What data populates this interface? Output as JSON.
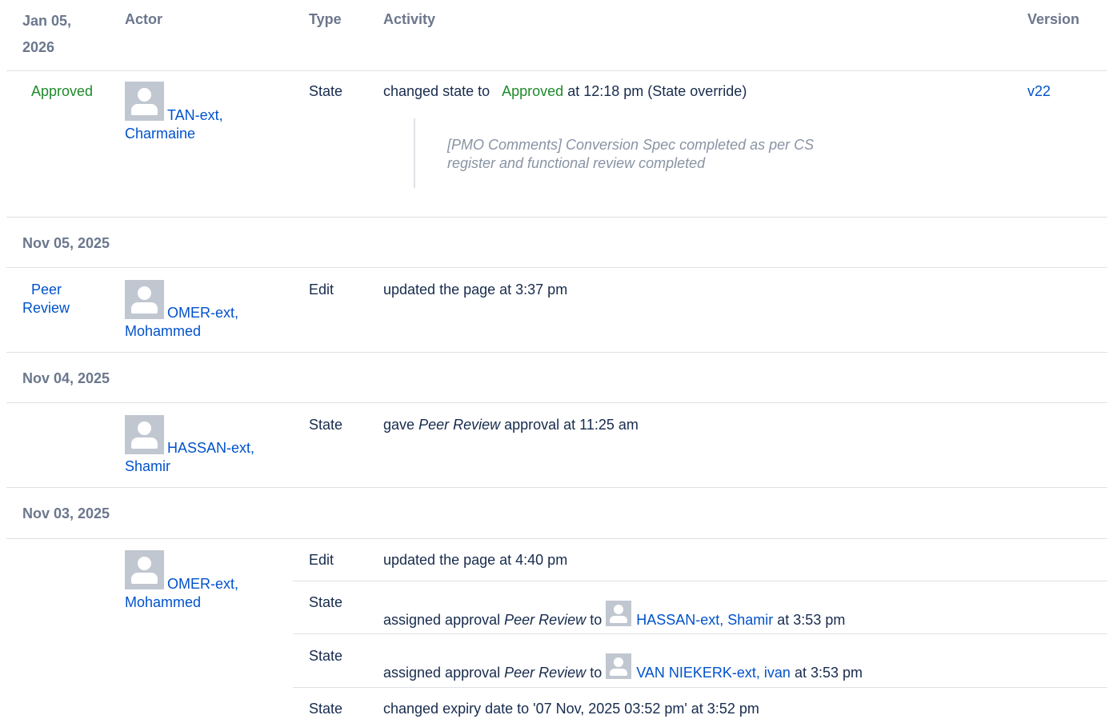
{
  "headers": {
    "date": "Jan 05, 2026",
    "actor": "Actor",
    "type": "Type",
    "activity": "Activity",
    "version": "Version"
  },
  "groups": [
    {
      "date": "Jan 05, 2026",
      "state_label": "Approved",
      "actor_name": "TAN-ext, Charmaine",
      "entries": [
        {
          "type": "State",
          "text_pre": "changed state to",
          "state": "Approved",
          "text_post": "at 12:18 pm (State override)",
          "version": "v22",
          "comment": "[PMO Comments] Conversion Spec completed as per CS register and functional review completed"
        }
      ]
    },
    {
      "date": "Nov 05, 2025",
      "state_label": "Peer Review",
      "actor_name": "OMER-ext, Mohammed",
      "entries": [
        {
          "type": "Edit",
          "text": "updated the page at 3:37 pm"
        }
      ]
    },
    {
      "date": "Nov 04, 2025",
      "actor_name": "HASSAN-ext, Shamir",
      "entries": [
        {
          "type": "State",
          "text_pre": "gave",
          "approval": "Peer Review",
          "text_post": "approval at 11:25 am"
        }
      ]
    },
    {
      "date": "Nov 03, 2025",
      "actor_name": "OMER-ext, Mohammed",
      "entries": [
        {
          "type": "Edit",
          "text": "updated the page at 4:40 pm"
        },
        {
          "type": "State",
          "text_pre": "assigned approval",
          "approval": "Peer Review",
          "text_mid": "to",
          "assignee": "HASSAN-ext, Shamir",
          "text_post": "at 3:53 pm"
        },
        {
          "type": "State",
          "text_pre": "assigned approval",
          "approval": "Peer Review",
          "text_mid": "to",
          "assignee": "VAN NIEKERK-ext, ivan",
          "text_post": "at 3:53 pm"
        },
        {
          "type": "State",
          "text": "changed expiry date to '07 Nov, 2025 03:52 pm' at 3:52 pm"
        }
      ]
    }
  ]
}
